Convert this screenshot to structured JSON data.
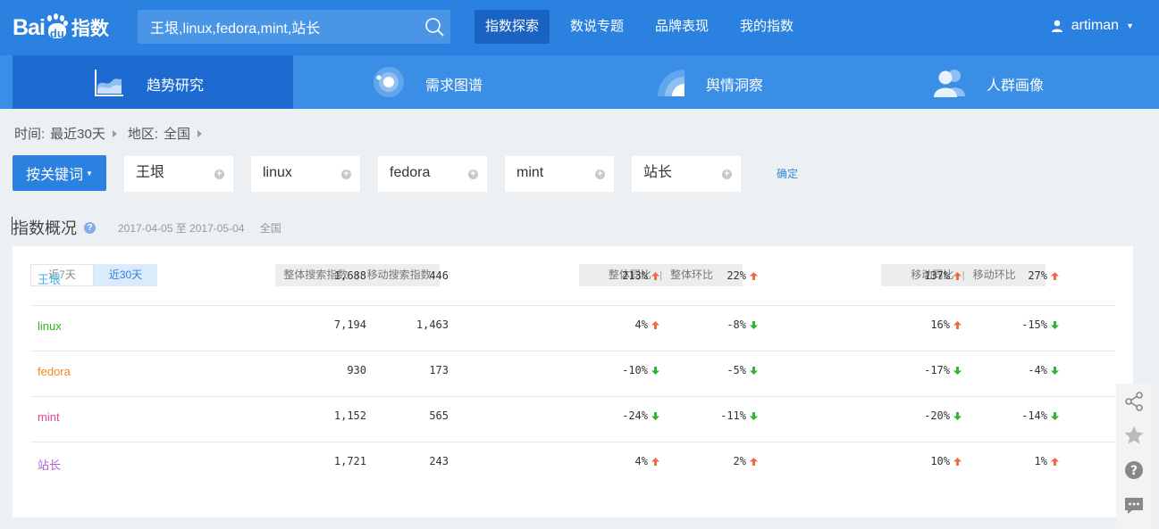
{
  "header": {
    "logo_text": "Bai",
    "logo_du": "du",
    "logo_zhi": "指数",
    "search_value": "王垠,linux,fedora,mint,站长",
    "nav": [
      {
        "label": "指数探索",
        "active": true
      },
      {
        "label": "数说专题",
        "active": false
      },
      {
        "label": "品牌表现",
        "active": false
      },
      {
        "label": "我的指数",
        "active": false
      }
    ],
    "username": "artiman"
  },
  "subnav": [
    {
      "label": "趋势研究",
      "icon": "trend-chart-icon",
      "active": true
    },
    {
      "label": "需求图谱",
      "icon": "demand-graph-icon",
      "active": false
    },
    {
      "label": "舆情洞察",
      "icon": "sentiment-icon",
      "active": false
    },
    {
      "label": "人群画像",
      "icon": "crowd-portrait-icon",
      "active": false
    }
  ],
  "filters": {
    "time_label": "时间:",
    "time_value": "最近30天",
    "region_label": "地区:",
    "region_value": "全国"
  },
  "keywords_row": {
    "button_label": "按关键词",
    "keywords": [
      "王垠",
      "linux",
      "fedora",
      "mint",
      "站长"
    ],
    "confirm_label": "确定"
  },
  "overview": {
    "title": "指数概况",
    "date_range": "2017-04-05 至 2017-05-04",
    "region": "全国",
    "range_tabs": [
      {
        "label": "近7天",
        "active": false
      },
      {
        "label": "近30天",
        "active": true
      }
    ],
    "headers": {
      "group1": [
        "整体搜索指数",
        "移动搜索指数"
      ],
      "group2": [
        "整体同比",
        "整体环比"
      ],
      "group3": [
        "移动同比",
        "移动环比"
      ]
    },
    "rows": [
      {
        "keyword": "王垠",
        "color": "#3fb3ef",
        "overall": "1,688",
        "mobile": "446",
        "overall_yoy": "213%",
        "overall_yoy_dir": "up",
        "overall_mom": "22%",
        "overall_mom_dir": "up",
        "mobile_yoy": "137%",
        "mobile_yoy_dir": "up",
        "mobile_mom": "27%",
        "mobile_mom_dir": "up"
      },
      {
        "keyword": "linux",
        "color": "#2db814",
        "overall": "7,194",
        "mobile": "1,463",
        "overall_yoy": "4%",
        "overall_yoy_dir": "up",
        "overall_mom": "-8%",
        "overall_mom_dir": "down",
        "mobile_yoy": "16%",
        "mobile_yoy_dir": "up",
        "mobile_mom": "-15%",
        "mobile_mom_dir": "down"
      },
      {
        "keyword": "fedora",
        "color": "#f08a1e",
        "overall": "930",
        "mobile": "173",
        "overall_yoy": "-10%",
        "overall_yoy_dir": "down",
        "overall_mom": "-5%",
        "overall_mom_dir": "down",
        "mobile_yoy": "-17%",
        "mobile_yoy_dir": "down",
        "mobile_mom": "-4%",
        "mobile_mom_dir": "down"
      },
      {
        "keyword": "mint",
        "color": "#e8459a",
        "overall": "1,152",
        "mobile": "565",
        "overall_yoy": "-24%",
        "overall_yoy_dir": "down",
        "overall_mom": "-11%",
        "overall_mom_dir": "down",
        "mobile_yoy": "-20%",
        "mobile_yoy_dir": "down",
        "mobile_mom": "-14%",
        "mobile_mom_dir": "down"
      },
      {
        "keyword": "站长",
        "color": "#b05fd6",
        "overall": "1,721",
        "mobile": "243",
        "overall_yoy": "4%",
        "overall_yoy_dir": "up",
        "overall_mom": "2%",
        "overall_mom_dir": "up",
        "mobile_yoy": "10%",
        "mobile_yoy_dir": "up",
        "mobile_mom": "1%",
        "mobile_mom_dir": "up"
      }
    ]
  },
  "colors": {
    "up": "#f0683c",
    "down": "#2ab52a",
    "brand": "#2b81e0"
  },
  "side_tools": [
    "share-icon",
    "star-icon",
    "help-icon",
    "feedback-icon"
  ]
}
